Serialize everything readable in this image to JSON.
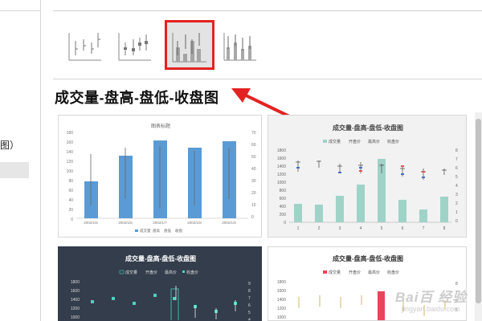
{
  "left_panel": {
    "item_label": "图）"
  },
  "section": {
    "title": "成交量-盘高-盘低-收盘图"
  },
  "thumbnails": [
    {
      "name": "high-low-close",
      "selected": false
    },
    {
      "name": "open-high-low-close",
      "selected": false
    },
    {
      "name": "volume-high-low-close",
      "selected": true
    },
    {
      "name": "volume-open-high-low-close",
      "selected": false
    }
  ],
  "preview1": {
    "title": "图表标题",
    "categories": [
      "2002/1/5",
      "2002/1/6",
      "2002/1/7",
      "2002/1/8",
      "2002/1/9"
    ],
    "left_ticks": [
      "180",
      "160",
      "140",
      "120",
      "100",
      "80",
      "60",
      "40",
      "20",
      "0"
    ],
    "right_ticks": [
      "70",
      "60",
      "50",
      "40",
      "30",
      "20",
      "10",
      "0"
    ],
    "legend": [
      "成交量",
      "盘高",
      "盘低",
      "收盘"
    ]
  },
  "preview2": {
    "title": "成交量-盘高-盘低-收盘图",
    "legend": [
      "成交量",
      "开盘价",
      "最高价",
      "收盘价"
    ],
    "left_ticks": [
      "1800",
      "1600",
      "1400",
      "1200",
      "1000",
      "800",
      "600",
      "400",
      "200",
      "0"
    ],
    "right_ticks": [
      "8",
      "7",
      "6",
      "5",
      "4",
      "3",
      "2",
      "1",
      "0"
    ],
    "categories": [
      "1",
      "2",
      "3",
      "4",
      "5",
      "6",
      "7",
      "8"
    ]
  },
  "preview3": {
    "title": "成交量-盘高-盘低-收盘图",
    "legend": [
      "成交量",
      "开盘价",
      "最高价",
      "收盘价"
    ],
    "left_ticks": [
      "1800",
      "1600",
      "1400",
      "1200",
      "1000"
    ],
    "right_ticks": [
      "9",
      "8",
      "7",
      "6",
      "5",
      "4"
    ]
  },
  "preview4": {
    "title": "成交量-盘高-盘低-收盘图",
    "legend": [
      "成交量",
      "开盘价",
      "最高价",
      "收盘价"
    ],
    "left_ticks": [
      "1800",
      "1600",
      "1400",
      "1200",
      "1000"
    ],
    "right_ticks": [
      "8",
      "7",
      "6",
      "5"
    ]
  },
  "watermark": {
    "text": "Bai百 经验",
    "sub": "jingyan.baidu.com"
  }
}
